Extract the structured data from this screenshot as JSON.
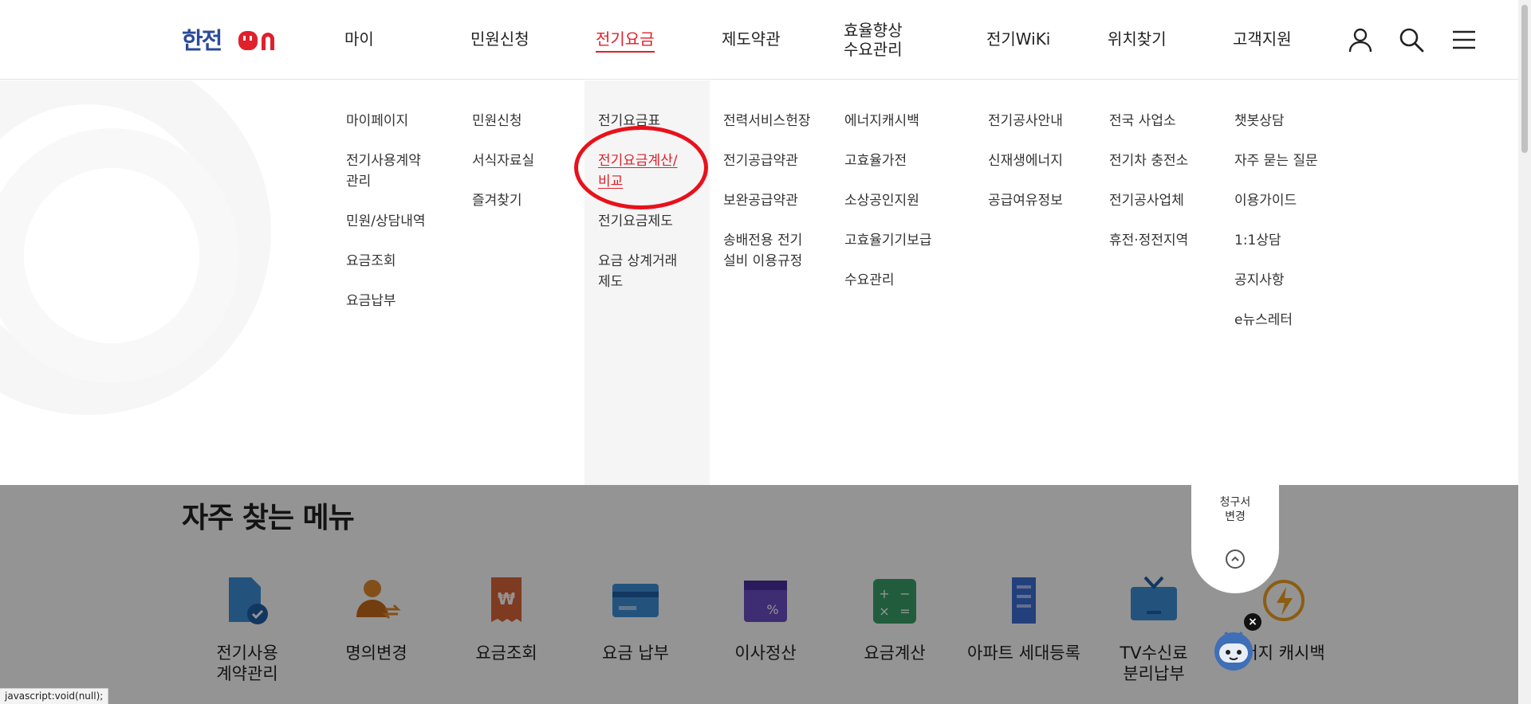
{
  "header": {
    "logo_text": "한전",
    "logo_suffix": "ON",
    "nav": [
      {
        "label": "마이"
      },
      {
        "label": "민원신청"
      },
      {
        "label": "전기요금"
      },
      {
        "label": "제도약관"
      },
      {
        "label": "효율향상\n수요관리"
      },
      {
        "label": "전기WiKi"
      },
      {
        "label": "위치찾기"
      },
      {
        "label": "고객지원"
      }
    ],
    "icons": [
      "user-icon",
      "search-icon",
      "menu-icon"
    ]
  },
  "mega_menu": {
    "columns": [
      {
        "items": [
          "마이페이지",
          "전기사용계약\n관리",
          "민원/상담내역",
          "요금조회",
          "요금납부"
        ]
      },
      {
        "items": [
          "민원신청",
          "서식자료실",
          "즐겨찾기"
        ]
      },
      {
        "items": [
          "전기요금표",
          "전기요금계산/\n비교",
          "전기요금제도",
          "요금 상계거래\n제도"
        ]
      },
      {
        "items": [
          "전력서비스헌장",
          "전기공급약관",
          "보완공급약관",
          "송배전용 전기\n설비 이용규정"
        ]
      },
      {
        "items": [
          "에너지캐시백",
          "고효율가전",
          "소상공인지원",
          "고효율기기보급",
          "수요관리"
        ]
      },
      {
        "items": [
          "전기공사안내",
          "신재생에너지",
          "공급여유정보"
        ]
      },
      {
        "items": [
          "전국 사업소",
          "전기차 충전소",
          "전기공사업체",
          "휴전·정전지역"
        ]
      },
      {
        "items": [
          "챗봇상담",
          "자주 묻는 질문",
          "이용가이드",
          "1:1상담",
          "공지사항",
          "e뉴스레터"
        ]
      }
    ]
  },
  "frequent_menu": {
    "title": "자주 찾는 메뉴",
    "items": [
      {
        "label": "전기사용\n계약관리",
        "icon": "document-check-icon",
        "color": "#3d8fd8"
      },
      {
        "label": "명의변경",
        "icon": "person-change-icon",
        "color": "#e0892c"
      },
      {
        "label": "요금조회",
        "icon": "won-receipt-icon",
        "color": "#d9663a"
      },
      {
        "label": "요금 납부",
        "icon": "credit-card-icon",
        "color": "#3d8fd8"
      },
      {
        "label": "이사정산",
        "icon": "calendar-percent-icon",
        "color": "#6b4fc4"
      },
      {
        "label": "요금계산",
        "icon": "calculator-icon",
        "color": "#3aa06a"
      },
      {
        "label": "아파트 세대등록",
        "icon": "apartment-icon",
        "color": "#3d6fd8"
      },
      {
        "label": "TV수신료\n분리납부",
        "icon": "tv-icon",
        "color": "#3d8fd8"
      },
      {
        "label": "너지 캐시백",
        "icon": "energy-cashback-icon",
        "color": "#f0a020"
      }
    ]
  },
  "floating": {
    "label": "청구서\n변경"
  },
  "statusbar": {
    "text": "javascript:void(null);"
  },
  "colors": {
    "brand_blue": "#2b4a9c",
    "accent_red": "#e0202b",
    "highlight_circle": "#e8111b"
  }
}
